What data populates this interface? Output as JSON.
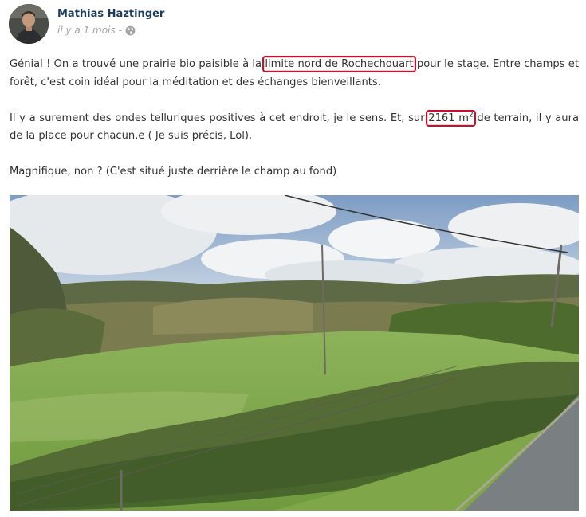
{
  "post": {
    "author": "Mathias Haztinger",
    "time": "il y a 1 mois",
    "separator": "-",
    "privacy_icon": "globe-icon",
    "paragraph1": {
      "before": "Génial ! On a trouvé une prairie bio paisible à la ",
      "highlight": "limite nord de Rochechouart",
      "after": " pour le stage. Entre champs et forêt, c'est coin idéal pour la méditation et des échanges bienveillants."
    },
    "paragraph2": {
      "before": "Il y a surement des ondes telluriques positives à cet endroit, je le sens. Et, sur ",
      "highlight_value": "2161 m",
      "highlight_sup": "2",
      "after": " de terrain, il y aura de la place pour chacun.e ( Je suis précis, Lol)."
    },
    "paragraph3": "Magnifique, non ? (C'est situé juste derrière le champ au fond)"
  },
  "colors": {
    "author": "#1d3b5c",
    "meta": "#a3a3a3",
    "highlight_box": "#c8102e",
    "text": "#333333"
  }
}
